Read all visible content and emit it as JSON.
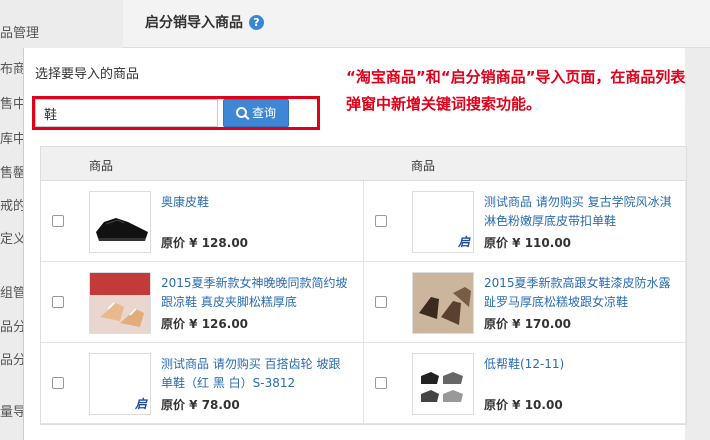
{
  "background": {
    "sidebar_items": [
      "品管理",
      "布商",
      "售中",
      "库中",
      "售罄",
      "戒的",
      "定义",
      "组管",
      "品分",
      "品分",
      "量导"
    ],
    "page_title": "启分销导入商品",
    "help_icon": "question-circle-icon"
  },
  "modal": {
    "title": "选择要导入的商品",
    "annotation": "“淘宝商品”和“启分销商品”导入页面，在商品列表弹窗中新增关键词搜索功能。",
    "search": {
      "value": "鞋",
      "button_label": "查询",
      "button_icon": "search-icon"
    },
    "columns": [
      "商品",
      "商品"
    ],
    "products": [
      [
        {
          "name": "奥康皮鞋",
          "price": "原价 ¥ 128.00",
          "thumb": "leather-shoe",
          "logo": ""
        },
        {
          "name": "测试商品 请勿购买 复古学院风冰淇淋色粉嫩厚底皮带扣单鞋",
          "price": "原价 ¥ 110.00",
          "thumb": "placeholder",
          "logo": "启"
        }
      ],
      [
        {
          "name": "2015夏季新款女神晚晚同款简约坡跟凉鞋 真皮夹脚松糕厚底",
          "price": "原价 ¥ 126.00",
          "thumb": "wedge-sandal",
          "logo": ""
        },
        {
          "name": "2015夏季新款高跟女鞋漆皮防水露趾罗马厚底松糕坡跟女凉鞋",
          "price": "原价 ¥ 170.00",
          "thumb": "platform-sandal",
          "logo": ""
        }
      ],
      [
        {
          "name": "测试商品 请勿购买 百搭齿轮 坡跟单鞋（红 黑 白）S-3812",
          "price": "原价 ¥ 78.00",
          "thumb": "placeholder",
          "logo": "启"
        },
        {
          "name": "低帮鞋(12-11)",
          "price": "原价 ¥ 10.00",
          "thumb": "low-shoes",
          "logo": ""
        }
      ]
    ]
  },
  "colors": {
    "accent": "#3f87d4",
    "annotation": "#e0001a",
    "link": "#2a6cb4"
  }
}
